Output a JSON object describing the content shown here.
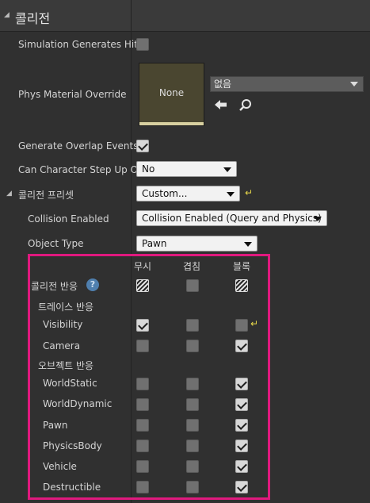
{
  "section": {
    "title": "콜리전"
  },
  "rows": {
    "sim_hit": {
      "label": "Simulation Generates Hit",
      "checked": false
    },
    "phys_material": {
      "label": "Phys Material Override",
      "thumbnail_text": "None",
      "combo_value": "없음"
    },
    "overlap": {
      "label": "Generate Overlap Events",
      "checked": true
    },
    "step_up": {
      "label": "Can Character Step Up O",
      "value": "No"
    },
    "preset": {
      "label": "콜리전 프리셋",
      "value": "Custom..."
    },
    "collision_enabled": {
      "label": "Collision Enabled",
      "value": "Collision Enabled (Query and Physics)"
    },
    "object_type": {
      "label": "Object Type",
      "value": "Pawn"
    }
  },
  "response_table": {
    "columns": [
      "무시",
      "겹침",
      "블록"
    ],
    "header_row": {
      "label": "콜리전 반응",
      "states": [
        "mixed",
        "off",
        "mixed"
      ]
    },
    "trace_group": {
      "label": "트레이스 반응",
      "items": [
        {
          "label": "Visibility",
          "states": [
            "on",
            "off",
            "off"
          ]
        },
        {
          "label": "Camera",
          "states": [
            "off",
            "off",
            "on"
          ]
        }
      ]
    },
    "object_group": {
      "label": "오브젝트 반응",
      "items": [
        {
          "label": "WorldStatic",
          "states": [
            "off",
            "off",
            "on"
          ]
        },
        {
          "label": "WorldDynamic",
          "states": [
            "off",
            "off",
            "on"
          ]
        },
        {
          "label": "Pawn",
          "states": [
            "off",
            "off",
            "on"
          ]
        },
        {
          "label": "PhysicsBody",
          "states": [
            "off",
            "off",
            "on"
          ]
        },
        {
          "label": "Vehicle",
          "states": [
            "off",
            "off",
            "on"
          ]
        },
        {
          "label": "Destructible",
          "states": [
            "off",
            "off",
            "on"
          ]
        }
      ]
    }
  },
  "icons": {
    "collapse": "triangle-down-icon",
    "help": "question-icon",
    "reset": "reset-arrow-icon",
    "back": "arrow-left-icon",
    "browse": "magnifier-icon"
  }
}
